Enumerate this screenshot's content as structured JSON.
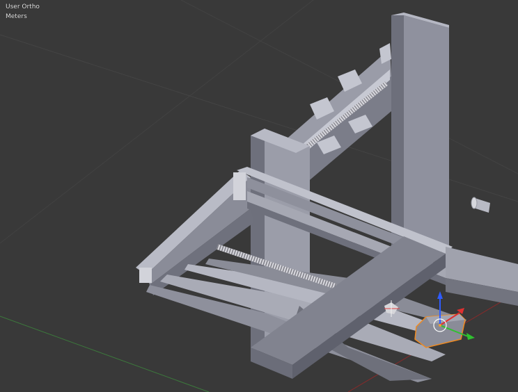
{
  "viewport": {
    "view_name": "User Ortho",
    "units": "Meters",
    "colors": {
      "background": "#393939",
      "grid_line": "#444444",
      "x_axis": "#8a2a2a",
      "y_axis": "#3c7a3c",
      "model_base": "#8a8c9a",
      "model_light": "#b4b6c2",
      "model_dark": "#5e606c",
      "selection_outline": "#f08a20",
      "manip_x": "#e03030",
      "manip_y": "#30c030",
      "manip_z": "#2f5cff"
    }
  },
  "objects": [
    {
      "name": "vertical-column"
    },
    {
      "name": "top-rail-assembly"
    },
    {
      "name": "frame-rails"
    },
    {
      "name": "lead-screw"
    },
    {
      "name": "front-crossbeam"
    },
    {
      "name": "loose-coupler"
    },
    {
      "name": "selected-motor-bracket"
    }
  ],
  "manipulator": {
    "axes": [
      "x",
      "y",
      "z"
    ]
  }
}
